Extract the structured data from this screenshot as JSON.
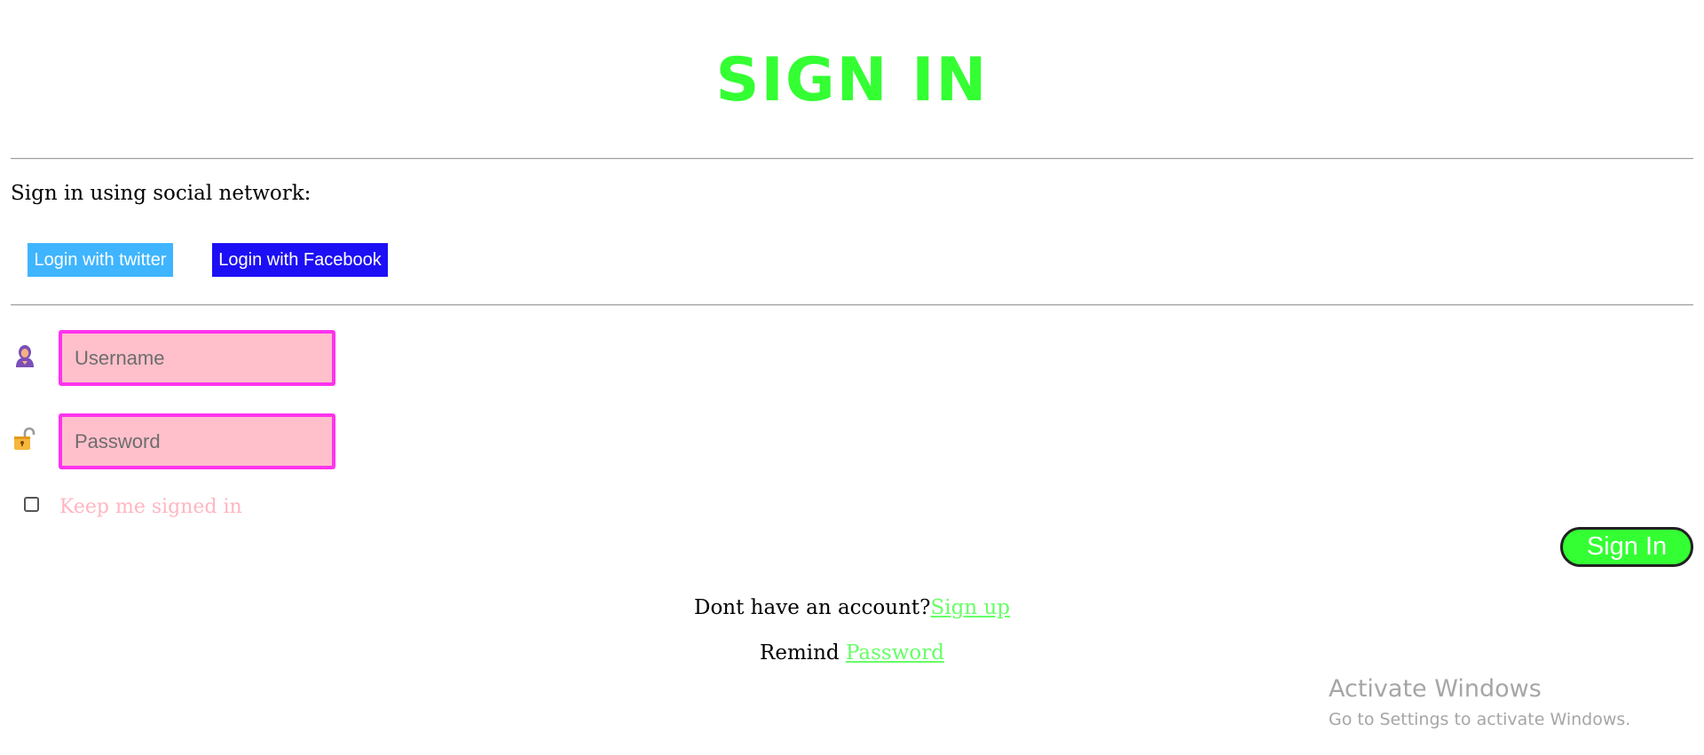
{
  "header": {
    "title": "SIGN IN"
  },
  "social": {
    "caption": "Sign in using social network:",
    "twitter_label": "Login with twitter",
    "facebook_label": "Login with Facebook"
  },
  "form": {
    "username": {
      "icon": "user-icon",
      "placeholder": "Username",
      "value": ""
    },
    "password": {
      "icon": "lock-icon",
      "placeholder": "Password",
      "value": ""
    },
    "keep_signed_in": {
      "label": "Keep me signed in",
      "checked": false
    },
    "submit_label": "Sign In"
  },
  "footer": {
    "signup_prompt": "Dont have an account?",
    "signup_link": "Sign up",
    "remind_prompt": "Remind ",
    "remind_link": "Password"
  },
  "watermark": {
    "title": "Activate Windows",
    "subtitle": "Go to Settings to activate Windows."
  },
  "colors": {
    "title": "#33ff33",
    "twitter": "#3fb5ff",
    "facebook": "#1c0ff5",
    "field_bg": "#ffc0cb",
    "field_border": "#ff33ee",
    "submit_bg": "#33ff33",
    "link": "#66ff66",
    "checkbox_label": "#ffb6c1"
  }
}
